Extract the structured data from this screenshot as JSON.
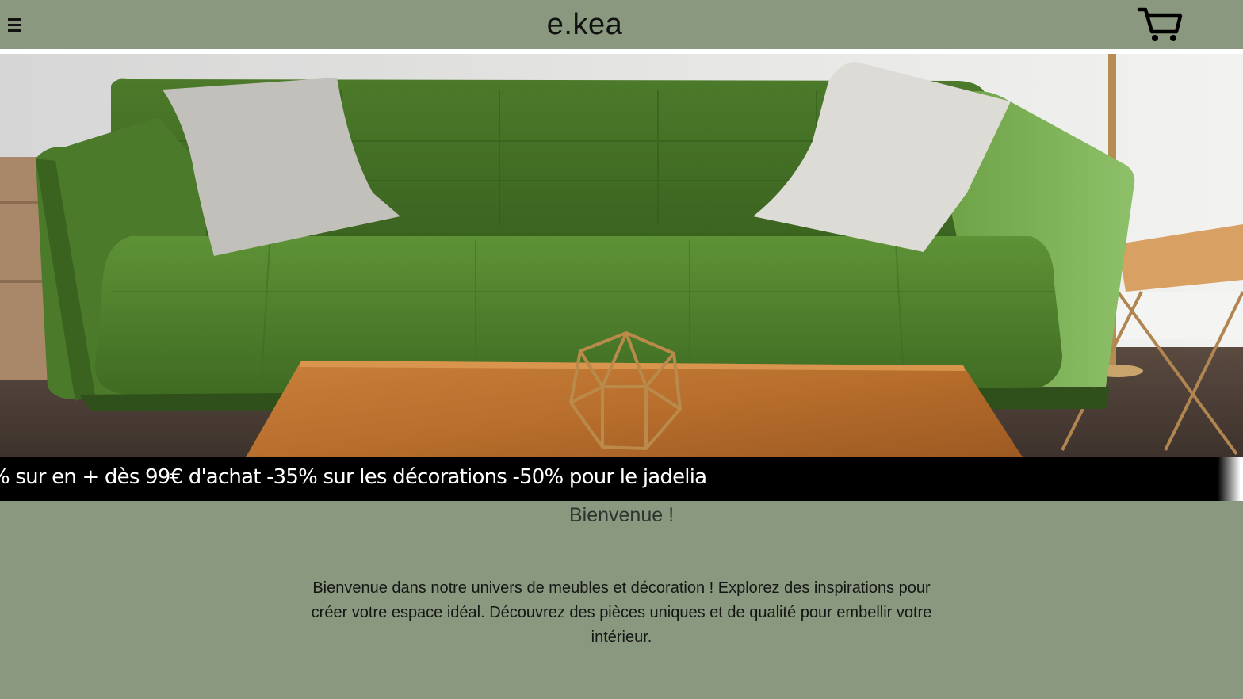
{
  "header": {
    "logo": "e.kea",
    "menu_icon": "hamburger-menu-icon",
    "cart_icon": "shopping-cart-icon"
  },
  "hero": {
    "image": "green-velvet-sofa-with-pillows-and-wooden-coffee-table"
  },
  "ticker": {
    "text": "% sur en + dès 99€ d'achat -35% sur les décorations -50% pour le jadelia"
  },
  "welcome": {
    "title": "Bienvenue !",
    "text": "Bienvenue dans notre univers de meubles et décoration ! Explorez des inspirations pour créer votre espace idéal. Découvrez des pièces uniques et de qualité pour embellir votre intérieur."
  },
  "colors": {
    "background": "#8a987f",
    "ticker_bg": "#000000",
    "ticker_text": "#ffffff"
  }
}
